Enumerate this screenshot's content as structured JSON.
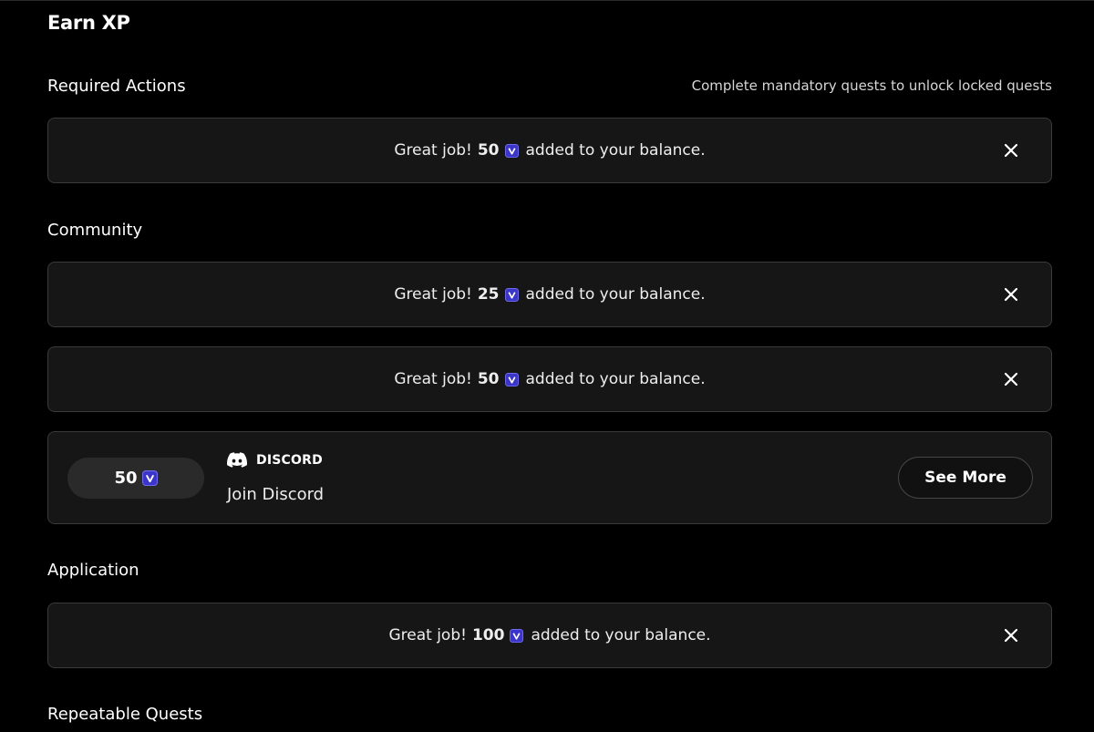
{
  "page_title": "Earn XP",
  "colors": {
    "background": "#000000",
    "card": "#161616",
    "card_border": "#3a3a3a",
    "xp_icon_fill": "#3b36c9"
  },
  "icons": {
    "xp": "xp-shield-v-icon",
    "close": "close-x-icon",
    "discord": "discord-icon"
  },
  "required_actions": {
    "label": "Required Actions",
    "hint": "Complete mandatory quests to unlock locked quests",
    "toasts": [
      {
        "prefix": "Great job!",
        "amount": "50",
        "suffix": "added to your balance."
      }
    ]
  },
  "community": {
    "label": "Community",
    "toasts": [
      {
        "prefix": "Great job!",
        "amount": "25",
        "suffix": "added to your balance."
      },
      {
        "prefix": "Great job!",
        "amount": "50",
        "suffix": "added to your balance."
      }
    ],
    "quest": {
      "reward": "50",
      "platform": "DISCORD",
      "name": "Join Discord",
      "button_label": "See More"
    }
  },
  "application": {
    "label": "Application",
    "toasts": [
      {
        "prefix": "Great job!",
        "amount": "100",
        "suffix": "added to your balance."
      }
    ]
  },
  "repeatable": {
    "label": "Repeatable Quests"
  }
}
